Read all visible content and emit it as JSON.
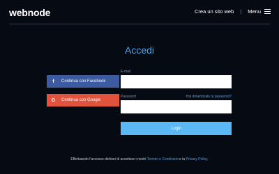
{
  "header": {
    "logo": "webnode",
    "create_site": "Crea un sito web",
    "separator": "|",
    "menu": "Menu"
  },
  "login": {
    "title": "Accedi",
    "facebook_label": "Continua con Facebook",
    "google_label": "Continua con Google",
    "email_label": "E-mail",
    "email_value": "",
    "password_label": "Password",
    "password_value": "",
    "forgot_label": "Hai dimenticato la password?",
    "submit_label": "Login"
  },
  "footer": {
    "terms_prefix": "Effettuando l'accesso dichiari di accettare i nostri",
    "terms_link": "Termini e Condizioni",
    "terms_middle": "e la",
    "privacy_link": "Privacy Policy",
    "terms_suffix": "."
  },
  "colors": {
    "background": "#060a12",
    "accent": "#4fa3e8",
    "facebook": "#3d5ba0",
    "google": "#e2533e",
    "button": "#5bb8f5"
  },
  "icons": {
    "facebook": "facebook-icon",
    "google": "google-icon",
    "menu": "hamburger-icon"
  }
}
